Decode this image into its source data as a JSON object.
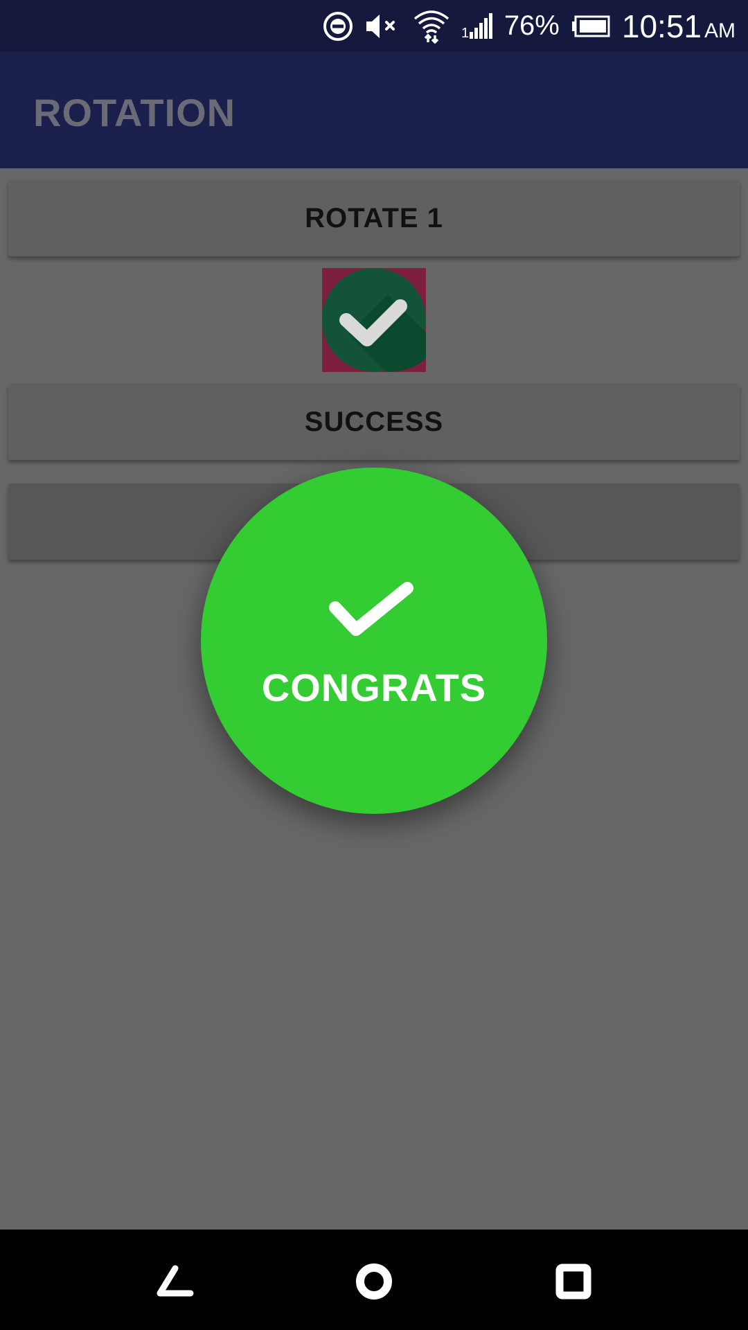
{
  "status_bar": {
    "icons": [
      "do-not-disturb-icon",
      "volume-muted-icon",
      "wifi-icon",
      "signal-icon",
      "battery-icon"
    ],
    "battery_percent": "76%",
    "time": "10:51",
    "ampm": "AM"
  },
  "app_bar": {
    "title": "ROTATION"
  },
  "buttons": {
    "rotate_label": "ROTATE 1",
    "success_label": "SUCCESS"
  },
  "image": {
    "icon": "check-circle-icon",
    "colors": {
      "background": "#7d1f3e",
      "circle": "#135338",
      "shadow": "#0b4a2e",
      "check": "#d9d9d9"
    }
  },
  "congrats": {
    "icon": "checkmark-icon",
    "label": "CONGRATS",
    "color": "#33cc33"
  },
  "nav_bar": {
    "icons": [
      "back-icon",
      "home-icon",
      "recent-apps-icon"
    ]
  },
  "colors": {
    "status_bar": "#14193d",
    "app_bar": "#1a1f4b",
    "scrim_background": "#676767",
    "button": "#606060"
  }
}
